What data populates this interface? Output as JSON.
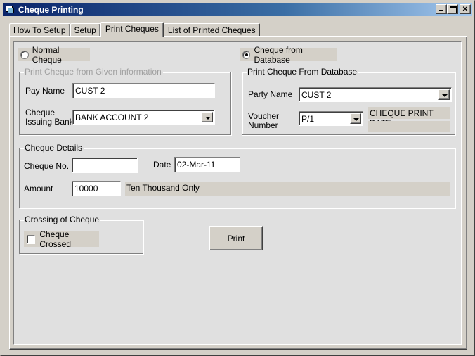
{
  "window": {
    "title": "Cheque Printing",
    "controls": {
      "minimize": "minimize",
      "maximize": "maximize",
      "close": "close"
    }
  },
  "tabs": [
    {
      "label": "How To Setup",
      "active": false
    },
    {
      "label": "Setup",
      "active": false
    },
    {
      "label": "Print Cheques",
      "active": true
    },
    {
      "label": "List of Printed Cheques",
      "active": false
    }
  ],
  "mode": {
    "normal_label": "Normal Cheque",
    "normal_checked": false,
    "database_label": "Cheque from Database",
    "database_checked": true
  },
  "given_info": {
    "title": "Print Cheque from Given information",
    "pay_name_label": "Pay Name",
    "pay_name_value": "CUST 2",
    "bank_label_line1": "Cheque",
    "bank_label_line2": "Issuing Bank",
    "bank_value": "BANK ACCOUNT 2"
  },
  "from_database": {
    "title": "Print Cheque From Database",
    "party_name_label": "Party Name",
    "party_name_value": "CUST 2",
    "voucher_label_line1": "Voucher",
    "voucher_label_line2": "Number",
    "voucher_value": "P/1",
    "print_date_label": "CHEQUE PRINT DATE",
    "print_date_value": ""
  },
  "details": {
    "title": "Cheque Details",
    "cheque_no_label": "Cheque No.",
    "cheque_no_value": "",
    "date_label": "Date",
    "date_value": "02-Mar-11",
    "amount_label": "Amount",
    "amount_value": "10000",
    "amount_words": "Ten Thousand Only"
  },
  "crossing": {
    "title": "Crossing of Cheque",
    "checkbox_label": "Cheque Crossed",
    "checked": false
  },
  "actions": {
    "print_label": "Print"
  }
}
